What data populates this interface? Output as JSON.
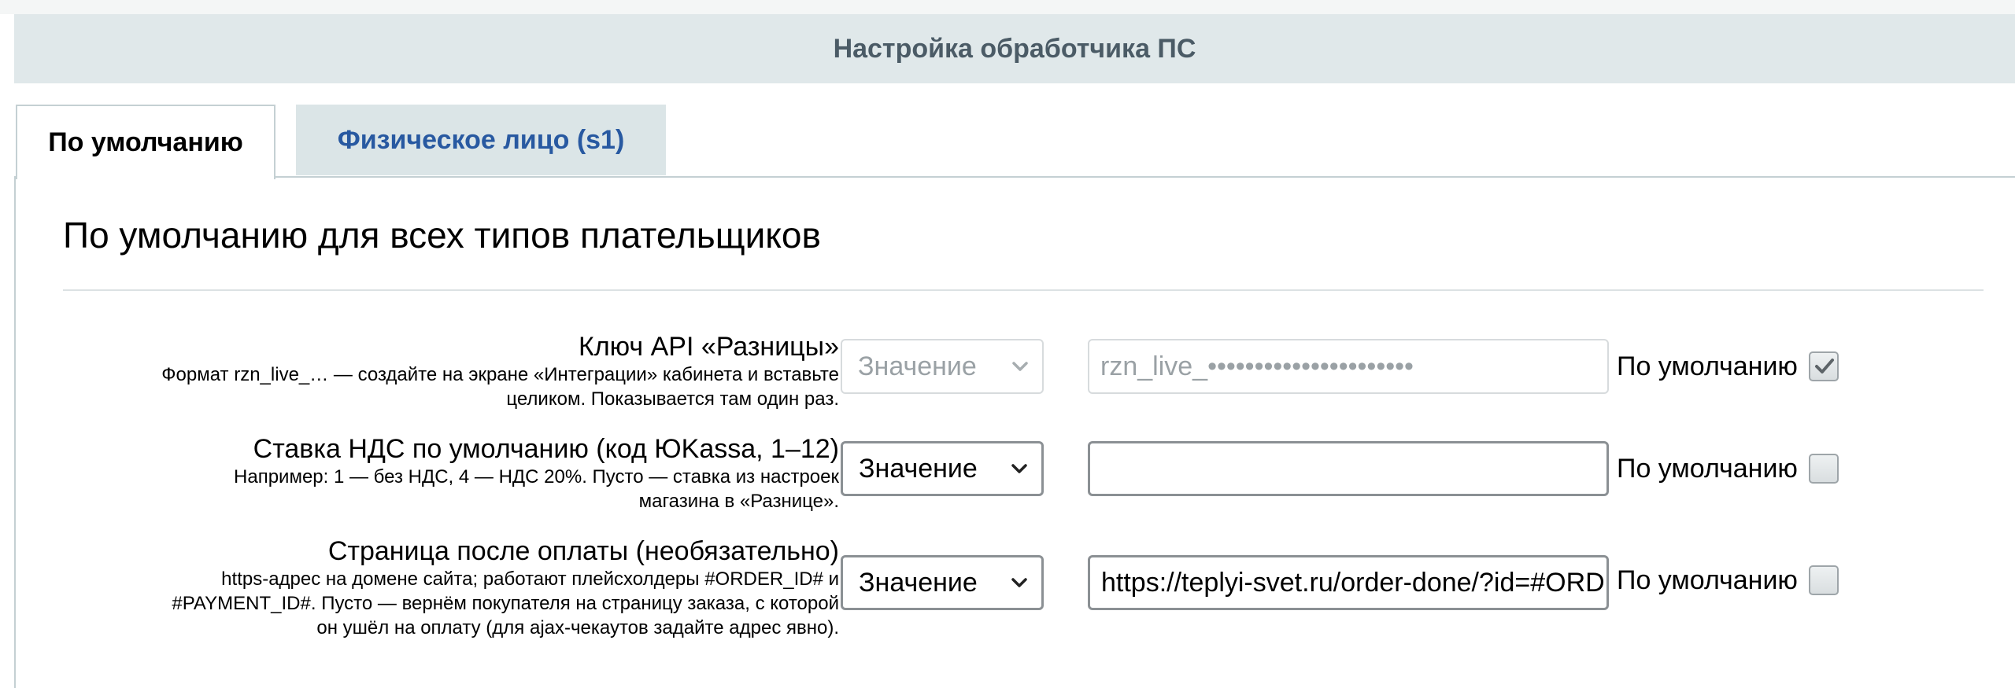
{
  "window": {
    "title": "Настройка обработчика ПС"
  },
  "tabs": [
    {
      "label": "По умолчанию",
      "active": true
    },
    {
      "label": "Физическое лицо (s1)",
      "active": false
    }
  ],
  "section": {
    "heading": "По умолчанию для всех типов плательщиков"
  },
  "rows": [
    {
      "label": "Ключ API «Разницы»",
      "hint_lines": [
        "Формат rzn_live_… — создайте на экране «Интеграции» кабинета и вставьте",
        "целиком. Показывается там один раз."
      ],
      "select_value": "Значение",
      "input_value": "rzn_live_••••••••••••••••••••••",
      "default_label": "По умолчанию",
      "default_checked": true,
      "disabled": true
    },
    {
      "label": "Ставка НДС по умолчанию (код ЮKassa, 1–12)",
      "hint_lines": [
        "Например: 1 — без НДС, 4 — НДС 20%. Пусто — ставка из настроек",
        "магазина в «Разнице»."
      ],
      "select_value": "Значение",
      "input_value": "",
      "default_label": "По умолчанию",
      "default_checked": false,
      "disabled": false
    },
    {
      "label": "Страница после оплаты (необязательно)",
      "hint_lines": [
        "https-адрес на домене сайта; работают плейсхолдеры #ORDER_ID# и",
        "#PAYMENT_ID#. Пусто — вернём покупателя на страницу заказа, с которой",
        "он ушёл на оплату (для ajax-чекаутов задайте адрес явно)."
      ],
      "select_value": "Значение",
      "input_value": "https://teplyi-svet.ru/order-done/?id=#ORDER_ID#",
      "default_label": "По умолчанию",
      "default_checked": false,
      "disabled": false
    }
  ],
  "colors": {
    "title_bar_bg": "#e0e8ea",
    "title_text": "#4b5b66",
    "inactive_tab_bg": "#dbe5e7",
    "inactive_tab_text": "#2859a1"
  }
}
